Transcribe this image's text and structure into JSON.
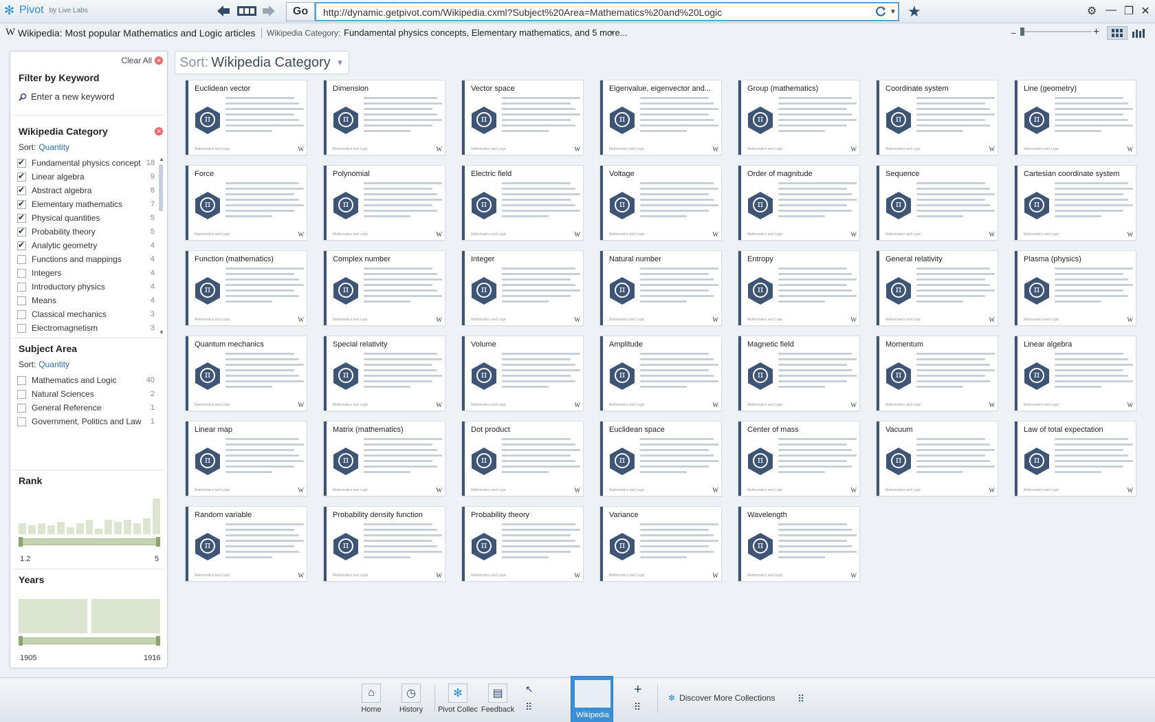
{
  "app": {
    "name": "Pivot",
    "subtitle": "by Live Labs"
  },
  "toolbar": {
    "go_label": "Go",
    "url": "http://dynamic.getpivot.com/Wikipedia.cxml?Subject%20Area=Mathematics%20and%20Logic"
  },
  "breadcrumb": {
    "title": "Wikipedia: Most popular Mathematics and Logic articles",
    "filter_label": "Wikipedia Category:",
    "filter_value": "Fundamental physics concepts, Elementary mathematics, and 5 more...",
    "chevron": "›"
  },
  "filters": {
    "clear_all": "Clear All",
    "keyword": {
      "title": "Filter by Keyword",
      "placeholder": "Enter a new keyword"
    },
    "category": {
      "title": "Wikipedia Category",
      "sort_label": "Sort:",
      "sort_value": "Quantity",
      "items": [
        {
          "label": "Fundamental physics concepts",
          "count": "18",
          "checked": true
        },
        {
          "label": "Linear algebra",
          "count": "9",
          "checked": true
        },
        {
          "label": "Abstract algebra",
          "count": "8",
          "checked": true
        },
        {
          "label": "Elementary mathematics",
          "count": "7",
          "checked": true
        },
        {
          "label": "Physical quantities",
          "count": "5",
          "checked": true
        },
        {
          "label": "Probability theory",
          "count": "5",
          "checked": true
        },
        {
          "label": "Analytic geometry",
          "count": "4",
          "checked": true
        },
        {
          "label": "Functions and mappings",
          "count": "4",
          "checked": false
        },
        {
          "label": "Integers",
          "count": "4",
          "checked": false
        },
        {
          "label": "Introductory physics",
          "count": "4",
          "checked": false
        },
        {
          "label": "Means",
          "count": "4",
          "checked": false
        },
        {
          "label": "Classical mechanics",
          "count": "3",
          "checked": false
        },
        {
          "label": "Electromagnetism",
          "count": "3",
          "checked": false
        }
      ]
    },
    "subject": {
      "title": "Subject Area",
      "sort_label": "Sort:",
      "sort_value": "Quantity",
      "items": [
        {
          "label": "Mathematics and Logic",
          "count": "40",
          "checked": false
        },
        {
          "label": "Natural Sciences",
          "count": "2",
          "checked": false
        },
        {
          "label": "General Reference",
          "count": "1",
          "checked": false
        },
        {
          "label": "Government, Politics and Law",
          "count": "1",
          "checked": false
        }
      ]
    },
    "rank": {
      "title": "Rank",
      "min_label": "1.2",
      "max_label": "5",
      "bars": [
        0.3,
        0.25,
        0.3,
        0.25,
        0.35,
        0.2,
        0.3,
        0.4,
        0.15,
        0.4,
        0.35,
        0.4,
        0.3,
        0.45,
        1.0
      ]
    },
    "years": {
      "title": "Years",
      "min_label": "1905",
      "max_label": "1916",
      "bars": [
        1.0,
        1.0
      ]
    }
  },
  "sort": {
    "label": "Sort:",
    "value": "Wikipedia Category"
  },
  "cards": [
    "Euclidean vector",
    "Dimension",
    "Vector space",
    "Eigenvalue, eigenvector and...",
    "Group (mathematics)",
    "Coordinate system",
    "Line (geometry)",
    "Force",
    "Polynomial",
    "Electric field",
    "Voltage",
    "Order of magnitude",
    "Sequence",
    "Cartesian coordinate system",
    "Function (mathematics)",
    "Complex number",
    "Integer",
    "Natural number",
    "Entropy",
    "General relativity",
    "Plasma (physics)",
    "Quantum mechanics",
    "Special relativity",
    "Volume",
    "Amplitude",
    "Magnetic field",
    "Momentum",
    "Linear algebra",
    "Linear map",
    "Matrix (mathematics)",
    "Dot product",
    "Euclidean space",
    "Center of mass",
    "Vacuum",
    "Law of total expectation",
    "Random variable",
    "Probability density function",
    "Probability theory",
    "Variance",
    "Wavelength"
  ],
  "card_footer": "Mathematics and Logic",
  "card_symbol": "π",
  "card_wiki_mark": "W",
  "taskbar": {
    "home": "Home",
    "history": "History",
    "pivot_collections": "Pivot Collec",
    "feedback": "Feedback",
    "active_tab": "Wikipedia",
    "discover": "Discover More Collections"
  },
  "colors": {
    "accent": "#2a8fd6",
    "card_stripe": "#3e5575",
    "range_green": "#c3d3b0"
  }
}
